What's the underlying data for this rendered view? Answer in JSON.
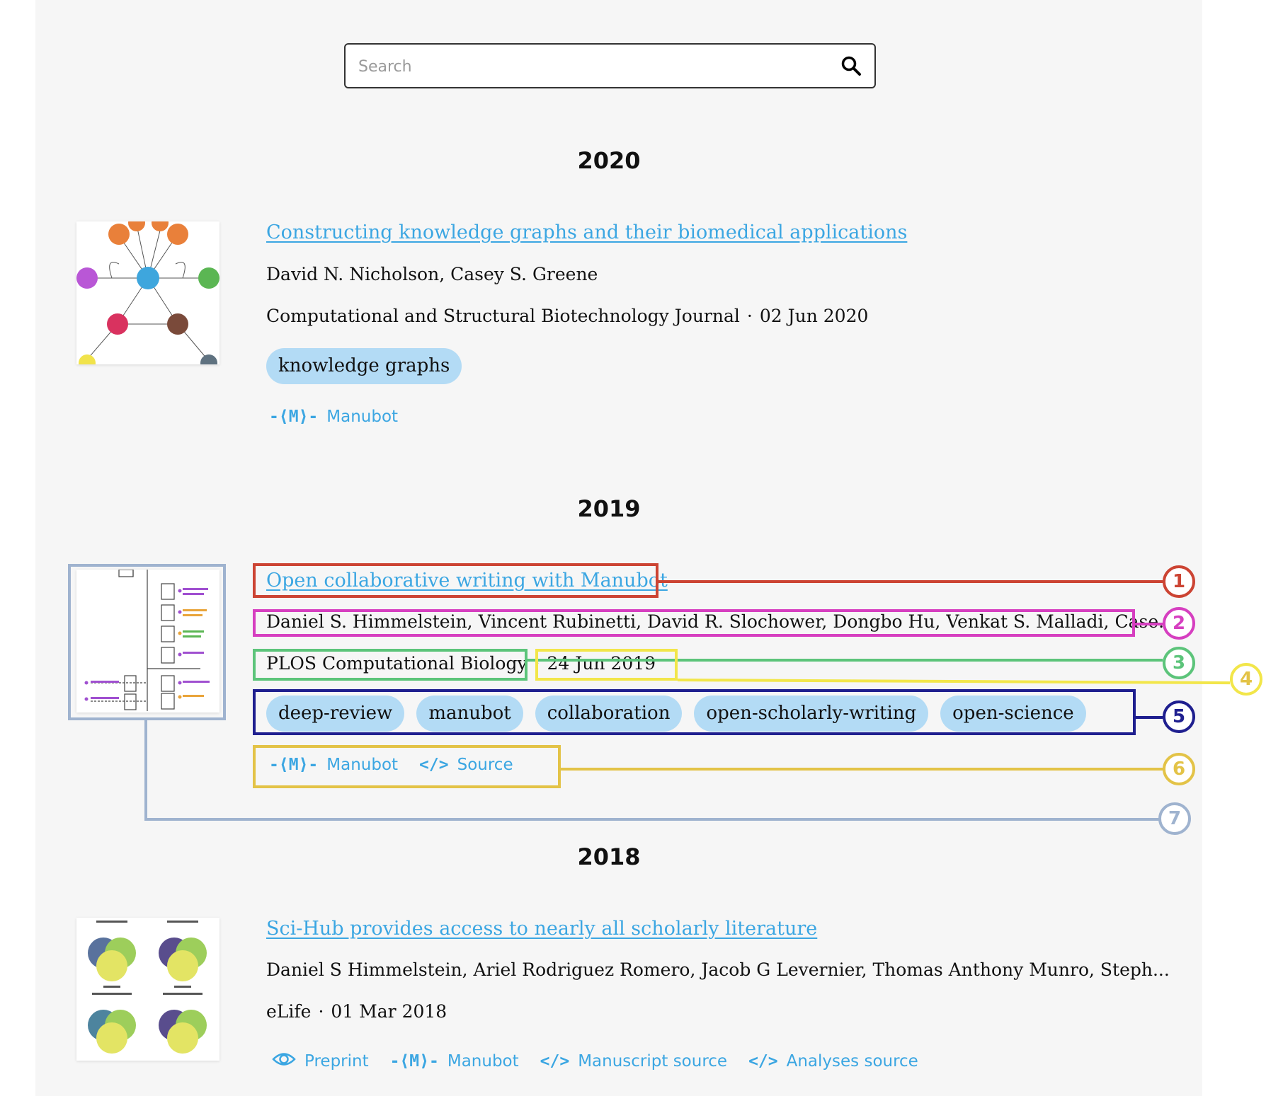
{
  "search": {
    "placeholder": "Search"
  },
  "papers": [
    {
      "year": "2020",
      "title": "Constructing knowledge graphs and their biomedical applications",
      "authors": "David N. Nicholson, Casey S. Greene",
      "journal": "Computational and Structural Biotechnology Journal",
      "date": "02 Jun 2020",
      "tags": [
        "knowledge graphs"
      ],
      "links": [
        {
          "icon": "manubot-icon",
          "label": "Manubot"
        }
      ]
    },
    {
      "year": "2019",
      "title": "Open collaborative writing with Manubot",
      "authors": "Daniel S. Himmelstein, Vincent Rubinetti, David R. Slochower, Dongbo Hu, Venkat S. Malladi, Case...",
      "journal": "PLOS Computational Biology",
      "date": "24 Jun 2019",
      "tags": [
        "deep-review",
        "manubot",
        "collaboration",
        "open-scholarly-writing",
        "open-science"
      ],
      "links": [
        {
          "icon": "manubot-icon",
          "label": "Manubot"
        },
        {
          "icon": "code-icon",
          "label": "Source"
        }
      ]
    },
    {
      "year": "2018",
      "title": "Sci-Hub provides access to nearly all scholarly literature",
      "authors": "Daniel S Himmelstein, Ariel Rodriguez Romero, Jacob G Levernier, Thomas Anthony Munro, Steph...",
      "journal": "eLife",
      "date": "01 Mar 2018",
      "tags": [],
      "links": [
        {
          "icon": "eye-icon",
          "label": "Preprint"
        },
        {
          "icon": "manubot-icon",
          "label": "Manubot"
        },
        {
          "icon": "code-icon",
          "label": "Manuscript source"
        },
        {
          "icon": "code-icon",
          "label": "Analyses source"
        }
      ]
    }
  ],
  "annotations": [
    {
      "number": "1",
      "color": "#cc4433"
    },
    {
      "number": "2",
      "color": "#d63fc0"
    },
    {
      "number": "3",
      "color": "#5cc47a"
    },
    {
      "number": "4",
      "color": "#f2e64a"
    },
    {
      "number": "5",
      "color": "#1f1f8f"
    },
    {
      "number": "6",
      "color": "#e3c347"
    },
    {
      "number": "7",
      "color": "#9fb3cf"
    }
  ],
  "colors": {
    "link": "#3ba6e2",
    "tag_bg": "#b3dbf5",
    "panel_bg": "#f6f6f6"
  }
}
